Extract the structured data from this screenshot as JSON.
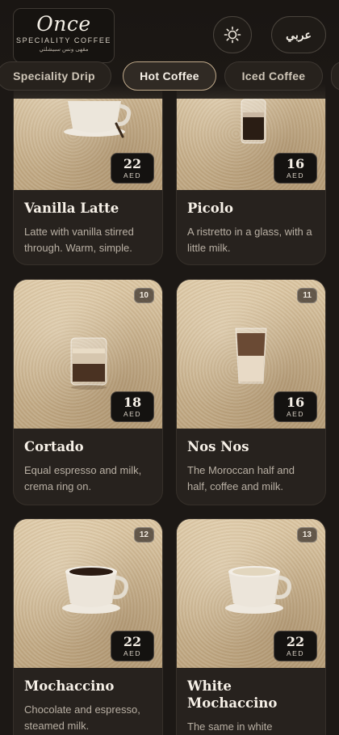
{
  "header": {
    "logo": {
      "word": "Once",
      "subtitle": "SPECIALITY COFFEE",
      "arabic": "مقهى ونس سبيشلتي"
    },
    "theme_icon": "sun-icon",
    "language_label": "عربي"
  },
  "tabs": [
    {
      "label": "Speciality Drip",
      "active": false
    },
    {
      "label": "Hot Coffee",
      "active": true
    },
    {
      "label": "Iced Coffee",
      "active": false
    }
  ],
  "products": [
    {
      "name": "Vanilla Latte",
      "description": "Latte with vanilla stirred through. Warm, simple.",
      "price": "22",
      "currency": "AED",
      "number": "",
      "drink": "cup-latte"
    },
    {
      "name": "Picolo",
      "description": "A ristretto in a glass, with a little milk.",
      "price": "16",
      "currency": "AED",
      "number": "",
      "drink": "glass-picolo"
    },
    {
      "name": "Cortado",
      "description": "Equal espresso and milk, crema ring on.",
      "price": "18",
      "currency": "AED",
      "number": "10",
      "drink": "glass-cortado"
    },
    {
      "name": "Nos Nos",
      "description": "The Moroccan half and half, coffee and milk.",
      "price": "16",
      "currency": "AED",
      "number": "11",
      "drink": "glass-nosnos"
    },
    {
      "name": "Mochaccino",
      "description": "Chocolate and espresso, steamed milk.",
      "price": "22",
      "currency": "AED",
      "number": "12",
      "drink": "cup-mocha"
    },
    {
      "name": "White Mochaccino",
      "description": "The same in white",
      "price": "22",
      "currency": "AED",
      "number": "13",
      "drink": "cup-white"
    }
  ]
}
